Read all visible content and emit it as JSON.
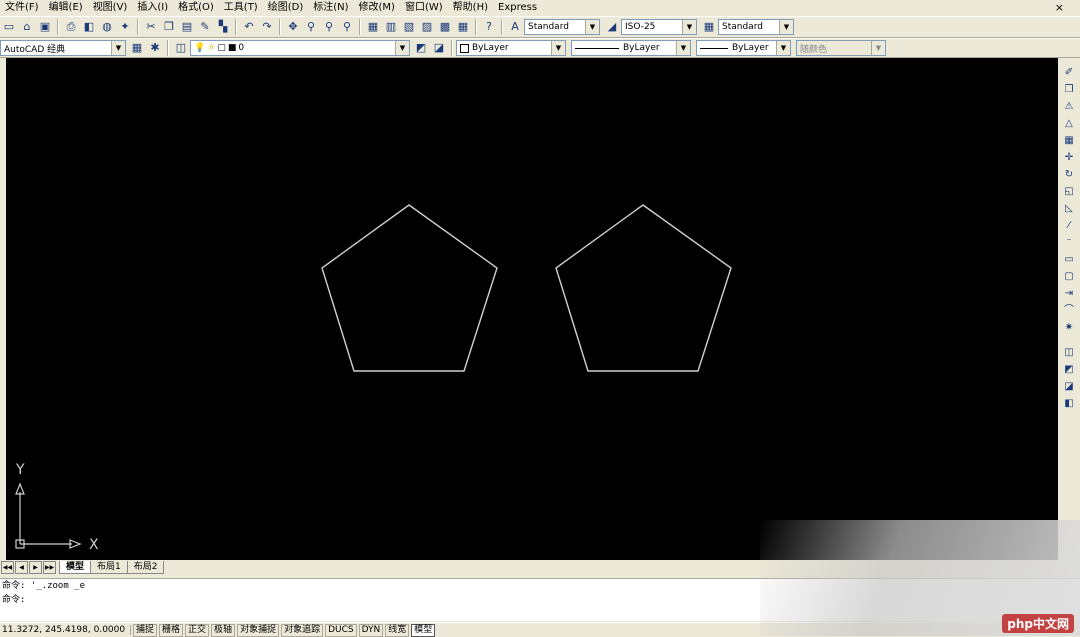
{
  "menu": {
    "items": [
      "文件(F)",
      "编辑(E)",
      "视图(V)",
      "插入(I)",
      "格式(O)",
      "工具(T)",
      "绘图(D)",
      "标注(N)",
      "修改(M)",
      "窗口(W)",
      "帮助(H)",
      "Express"
    ],
    "close": "×"
  },
  "toolbar1": {
    "text_style": "Standard",
    "dim_style": "ISO-25",
    "table_style": "Standard"
  },
  "toolbar2": {
    "workspace": "AutoCAD 经典",
    "layer": "0",
    "color": "ByLayer",
    "linetype": "ByLayer",
    "lineweight": "ByLayer",
    "plotstyle": "随颜色"
  },
  "ucs": {
    "y_label": "Y",
    "x_label": "X"
  },
  "layout_tabs": [
    "模型",
    "布局1",
    "布局2"
  ],
  "command": {
    "line1": "命令: '_.zoom _e",
    "line2": "命令:"
  },
  "status": {
    "coords": "11.3272, 245.4198, 0.0000",
    "buttons": [
      "捕捉",
      "栅格",
      "正交",
      "极轴",
      "对象捕捉",
      "对象追踪",
      "DUCS",
      "DYN",
      "线宽",
      "模型"
    ]
  },
  "watermark": "php中文网",
  "colors": {
    "canvas": "#000000",
    "geometry": "#cfcfcf",
    "chrome": "#ece9d8"
  }
}
